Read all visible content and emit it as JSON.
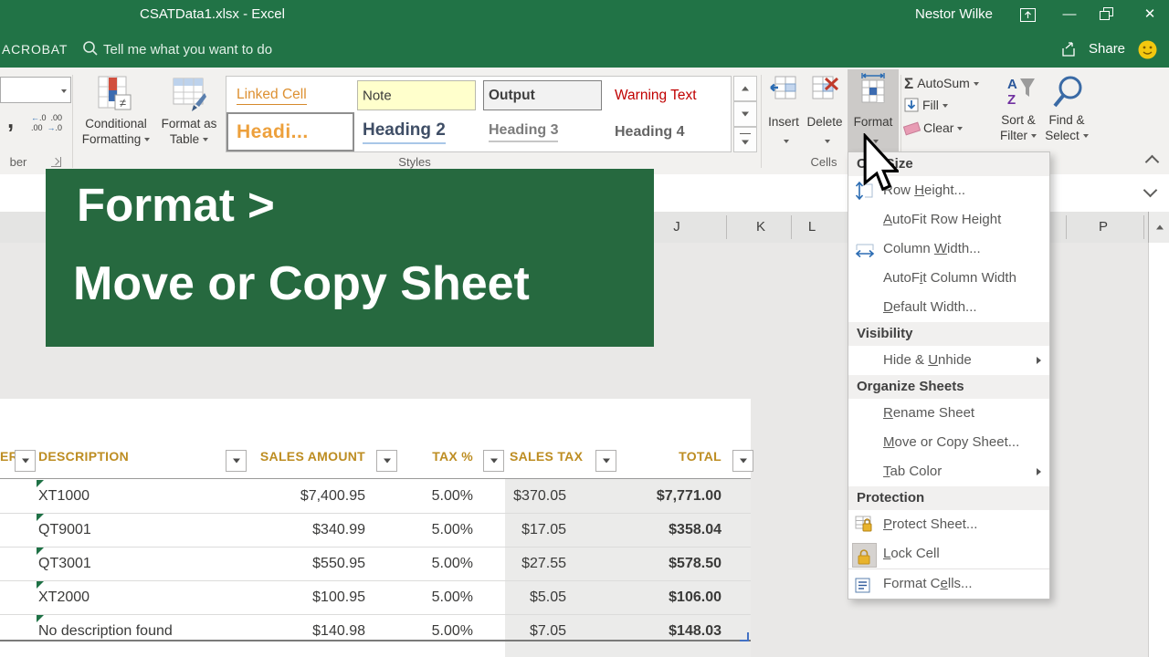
{
  "window": {
    "title": "CSATData1.xlsx  -  Excel",
    "user": "Nestor Wilke"
  },
  "tabs": {
    "acrobat": "ACROBAT",
    "tell_me": "Tell me what you want to do",
    "share_label": "Share"
  },
  "ribbon": {
    "conditional_formatting_line1": "Conditional",
    "conditional_formatting_line2": "Formatting",
    "format_as_table_line1": "Format as",
    "format_as_table_line2": "Table",
    "number_group_label": "ber",
    "styles_group_label": "Styles",
    "cells_group_label": "Cells",
    "insert_label": "Insert",
    "delete_label": "Delete",
    "format_label": "Format",
    "autosum_label": "AutoSum",
    "fill_label": "Fill",
    "clear_label": "Clear",
    "sort_filter_line1": "Sort &",
    "sort_filter_line2": "Filter",
    "find_select_line1": "Find &",
    "find_select_line2": "Select",
    "gallery": [
      {
        "label": "Linked Cell"
      },
      {
        "label": "Note"
      },
      {
        "label": "Output"
      },
      {
        "label": "Warning Text"
      },
      {
        "label": "Headi..."
      },
      {
        "label": "Heading 2"
      },
      {
        "label": "Heading 3"
      },
      {
        "label": "Heading 4"
      }
    ]
  },
  "format_menu": {
    "entries": [
      {
        "type": "header",
        "label": "Cell Size"
      },
      {
        "type": "item",
        "pre": "Row ",
        "accel": "H",
        "post": "eight..."
      },
      {
        "type": "item",
        "pre": "",
        "accel": "A",
        "post": "utoFit Row Height"
      },
      {
        "type": "item",
        "pre": "Column ",
        "accel": "W",
        "post": "idth..."
      },
      {
        "type": "item",
        "pre": "AutoF",
        "accel": "i",
        "post": "t Column Width"
      },
      {
        "type": "item",
        "pre": "",
        "accel": "D",
        "post": "efault Width..."
      },
      {
        "type": "header",
        "label": "Visibility"
      },
      {
        "type": "item",
        "pre": "Hide & ",
        "accel": "U",
        "post": "nhide"
      },
      {
        "type": "header",
        "label": "Organize Sheets"
      },
      {
        "type": "item",
        "pre": "",
        "accel": "R",
        "post": "ename Sheet"
      },
      {
        "type": "item",
        "pre": "",
        "accel": "M",
        "post": "ove or Copy Sheet..."
      },
      {
        "type": "item",
        "pre": "",
        "accel": "T",
        "post": "ab Color"
      },
      {
        "type": "header",
        "label": "Protection"
      },
      {
        "type": "item",
        "pre": "",
        "accel": "P",
        "post": "rotect Sheet..."
      },
      {
        "type": "item",
        "pre": "",
        "accel": "L",
        "post": "ock Cell"
      },
      {
        "type": "item",
        "pre": "Format C",
        "accel": "e",
        "post": "lls..."
      }
    ]
  },
  "banner": {
    "line1": "Format >",
    "line2": "Move or Copy Sheet"
  },
  "sheet": {
    "columns": [
      "J",
      "K",
      "L",
      "P"
    ]
  },
  "table": {
    "headers": {
      "col0": "ER",
      "description": "DESCRIPTION",
      "sales_amount": "SALES AMOUNT",
      "tax_pct": "TAX %",
      "sales_tax": "SALES TAX",
      "total": "TOTAL"
    },
    "rows": [
      {
        "description": "XT1000",
        "sales_amount": "$7,400.95",
        "tax_pct": "5.00%",
        "sales_tax": "$370.05",
        "total": "$7,771.00"
      },
      {
        "description": "QT9001",
        "sales_amount": "$340.99",
        "tax_pct": "5.00%",
        "sales_tax": "$17.05",
        "total": "$358.04"
      },
      {
        "description": "QT3001",
        "sales_amount": "$550.95",
        "tax_pct": "5.00%",
        "sales_tax": "$27.55",
        "total": "$578.50"
      },
      {
        "description": "XT2000",
        "sales_amount": "$100.95",
        "tax_pct": "5.00%",
        "sales_tax": "$5.05",
        "total": "$106.00"
      },
      {
        "description": "No description found",
        "sales_amount": "$140.98",
        "tax_pct": "5.00%",
        "sales_tax": "$7.05",
        "total": "$148.03"
      }
    ]
  },
  "colors": {
    "excel_green": "#217346",
    "banner_green": "#26693f",
    "header_gold": "#bd8d22",
    "total_orange": "#e8a33d",
    "warning_red": "#c00000"
  }
}
